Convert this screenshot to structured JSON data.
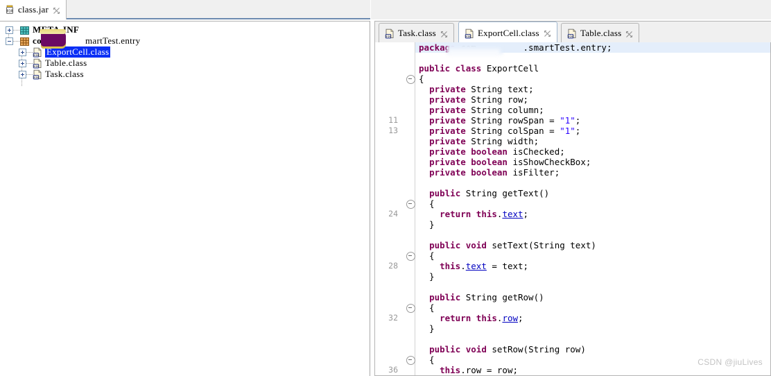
{
  "window": {
    "watermark": "CSDN @jiuLives"
  },
  "jar_view": {
    "tab": {
      "label": "class.jar",
      "icon": "jar-icon",
      "close_icon": "close-icon"
    },
    "tree": [
      {
        "label": "META-INF",
        "icon": "package-folder-icon",
        "expander": "plus",
        "depth": 0,
        "selected": false,
        "bold": true
      },
      {
        "label": "com",
        "suffix": "martTest.entry",
        "icon": "package-folder-icon",
        "expander": "minus",
        "depth": 0,
        "selected": false,
        "bold": true,
        "redacted": true
      },
      {
        "label": "ExportCell.class",
        "icon": "class-file-icon",
        "expander": "plus",
        "depth": 1,
        "selected": true,
        "bold": false
      },
      {
        "label": "Table.class",
        "icon": "class-file-icon",
        "expander": "plus",
        "depth": 1,
        "selected": false,
        "bold": false
      },
      {
        "label": "Task.class",
        "icon": "class-file-icon",
        "expander": "plus",
        "depth": 1,
        "selected": false,
        "bold": false
      }
    ]
  },
  "editor": {
    "tabs": [
      {
        "label": "Task.class",
        "icon": "class-file-icon",
        "close_icon": "close-icon",
        "active": false
      },
      {
        "label": "ExportCell.class",
        "icon": "class-file-icon",
        "close_icon": "close-icon",
        "active": true
      },
      {
        "label": "Table.class",
        "icon": "class-file-icon",
        "close_icon": "close-icon",
        "active": false
      }
    ],
    "line_numbers": [
      "11",
      "13",
      "24",
      "28",
      "32",
      "36"
    ],
    "code_lines": [
      "package com         .smartTest.entry;",
      "",
      "public class ExportCell",
      "{",
      "  private String text;",
      "  private String row;",
      "  private String column;",
      "  private String rowSpan = \"1\";",
      "  private String colSpan = \"1\";",
      "  private String width;",
      "  private boolean isChecked;",
      "  private boolean isShowCheckBox;",
      "  private boolean isFilter;",
      "",
      "  public String getText()",
      "  {",
      "    return this.text;",
      "  }",
      "",
      "  public void setText(String text)",
      "  {",
      "    this.text = text;",
      "  }",
      "",
      "  public String getRow()",
      "  {",
      "    return this.row;",
      "  }",
      "",
      "  public void setRow(String row)",
      "  {",
      "    this.row = row;"
    ],
    "colors": {
      "keyword": "#7f0055",
      "string": "#2a00ff",
      "field": "#0000c0",
      "selection": "#0a2ff5",
      "current_line": "#e4eefb"
    }
  }
}
